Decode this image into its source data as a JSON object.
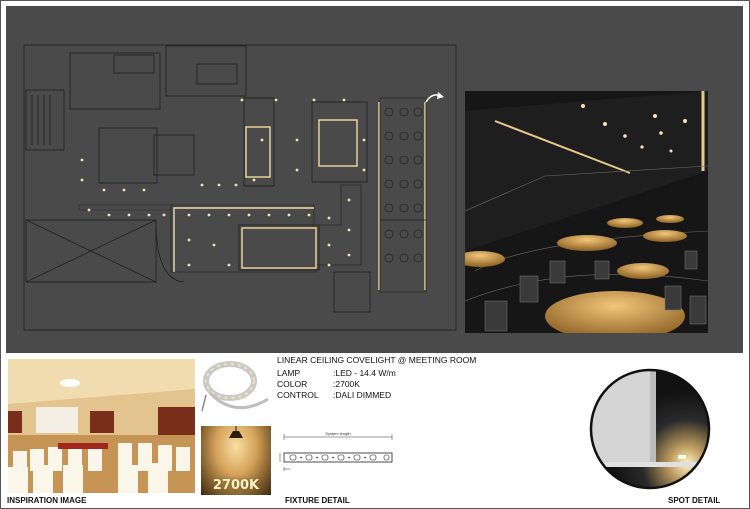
{
  "specs": {
    "title": "LINEAR CEILING COVELIGHT @  MEETING ROOM",
    "rows": [
      {
        "key": "LAMP",
        "value": ":LED - 14.4 W/m"
      },
      {
        "key": "COLOR",
        "value": ":2700K"
      },
      {
        "key": "CONTROL",
        "value": ":DALI DIMMED"
      }
    ]
  },
  "labels": {
    "inspiration": "INSPIRATION IMAGE",
    "fixture": "FIXTURE DETAIL",
    "spot": "SPOT DETAIL"
  },
  "color_temp_badge": "2700K",
  "fixture_dim_label": "System length",
  "icons": {
    "north_arrow": "curved-arrow-icon"
  },
  "colors": {
    "plan_background": "#4a4a4a",
    "cove_light": "#f3d9a0",
    "warm_light": "#e9c98a"
  }
}
